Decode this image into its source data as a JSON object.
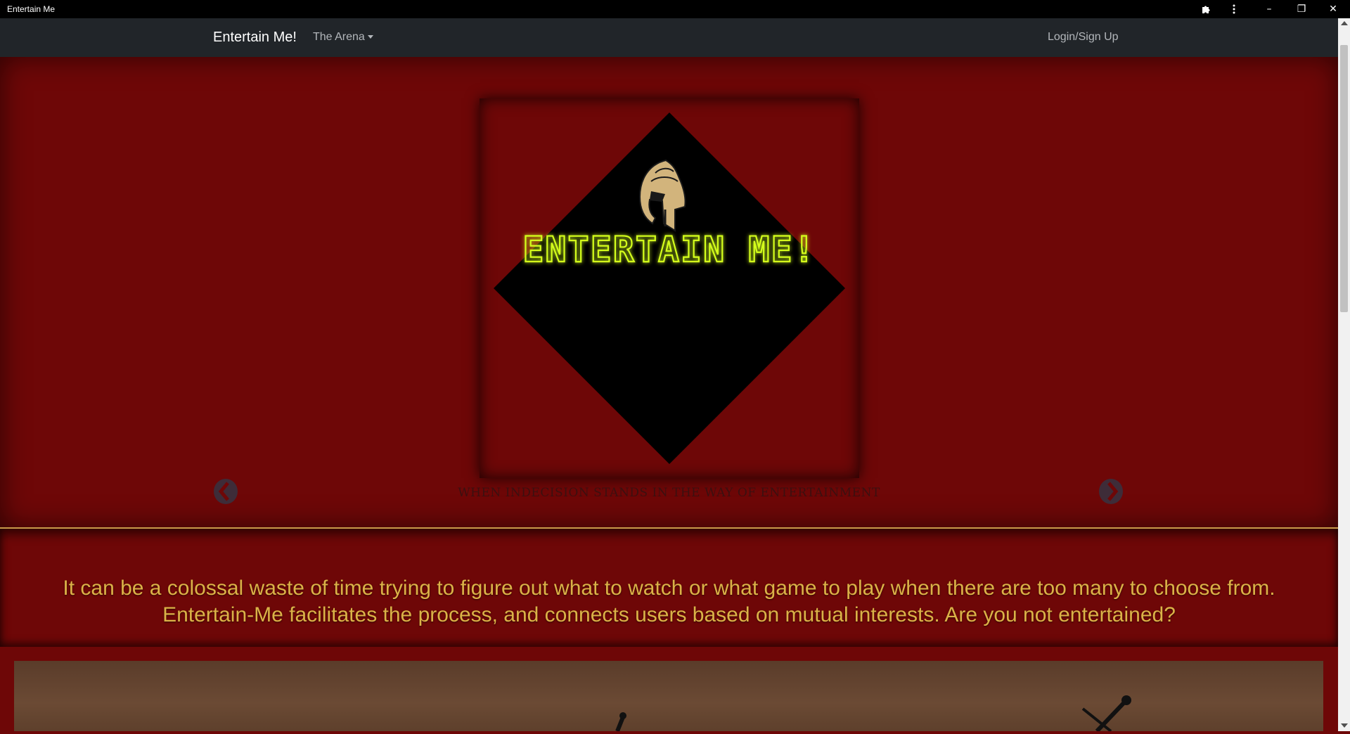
{
  "window": {
    "title": "Entertain Me",
    "controls": {
      "extensions_icon": "puzzle-icon",
      "menu_icon": "kebab-icon",
      "minimize": "–",
      "restore": "❐",
      "close": "✕"
    }
  },
  "navbar": {
    "brand": "Entertain Me!",
    "dropdown_label": "The Arena",
    "login_label": "Login/Sign Up"
  },
  "hero": {
    "logo_text": "ENTERTAIN ME!",
    "logo_icon": "spartan-helmet-icon",
    "tagline": "WHEN INDECISION STANDS IN THE WAY OF ENTERTAINMENT",
    "prev_icon": "chevron-left-icon",
    "next_icon": "chevron-right-icon"
  },
  "about": {
    "text": "It can be a colossal waste of time trying to figure out what to watch or what game to play when there are too many to choose from. Entertain-Me facilitates the process, and connects users based on mutual interests. Are you not entertained?"
  },
  "colors": {
    "background": "#6e0707",
    "navbar": "#212529",
    "accent_gold": "#dbb247",
    "logo_neon": "#d4ff1a"
  }
}
